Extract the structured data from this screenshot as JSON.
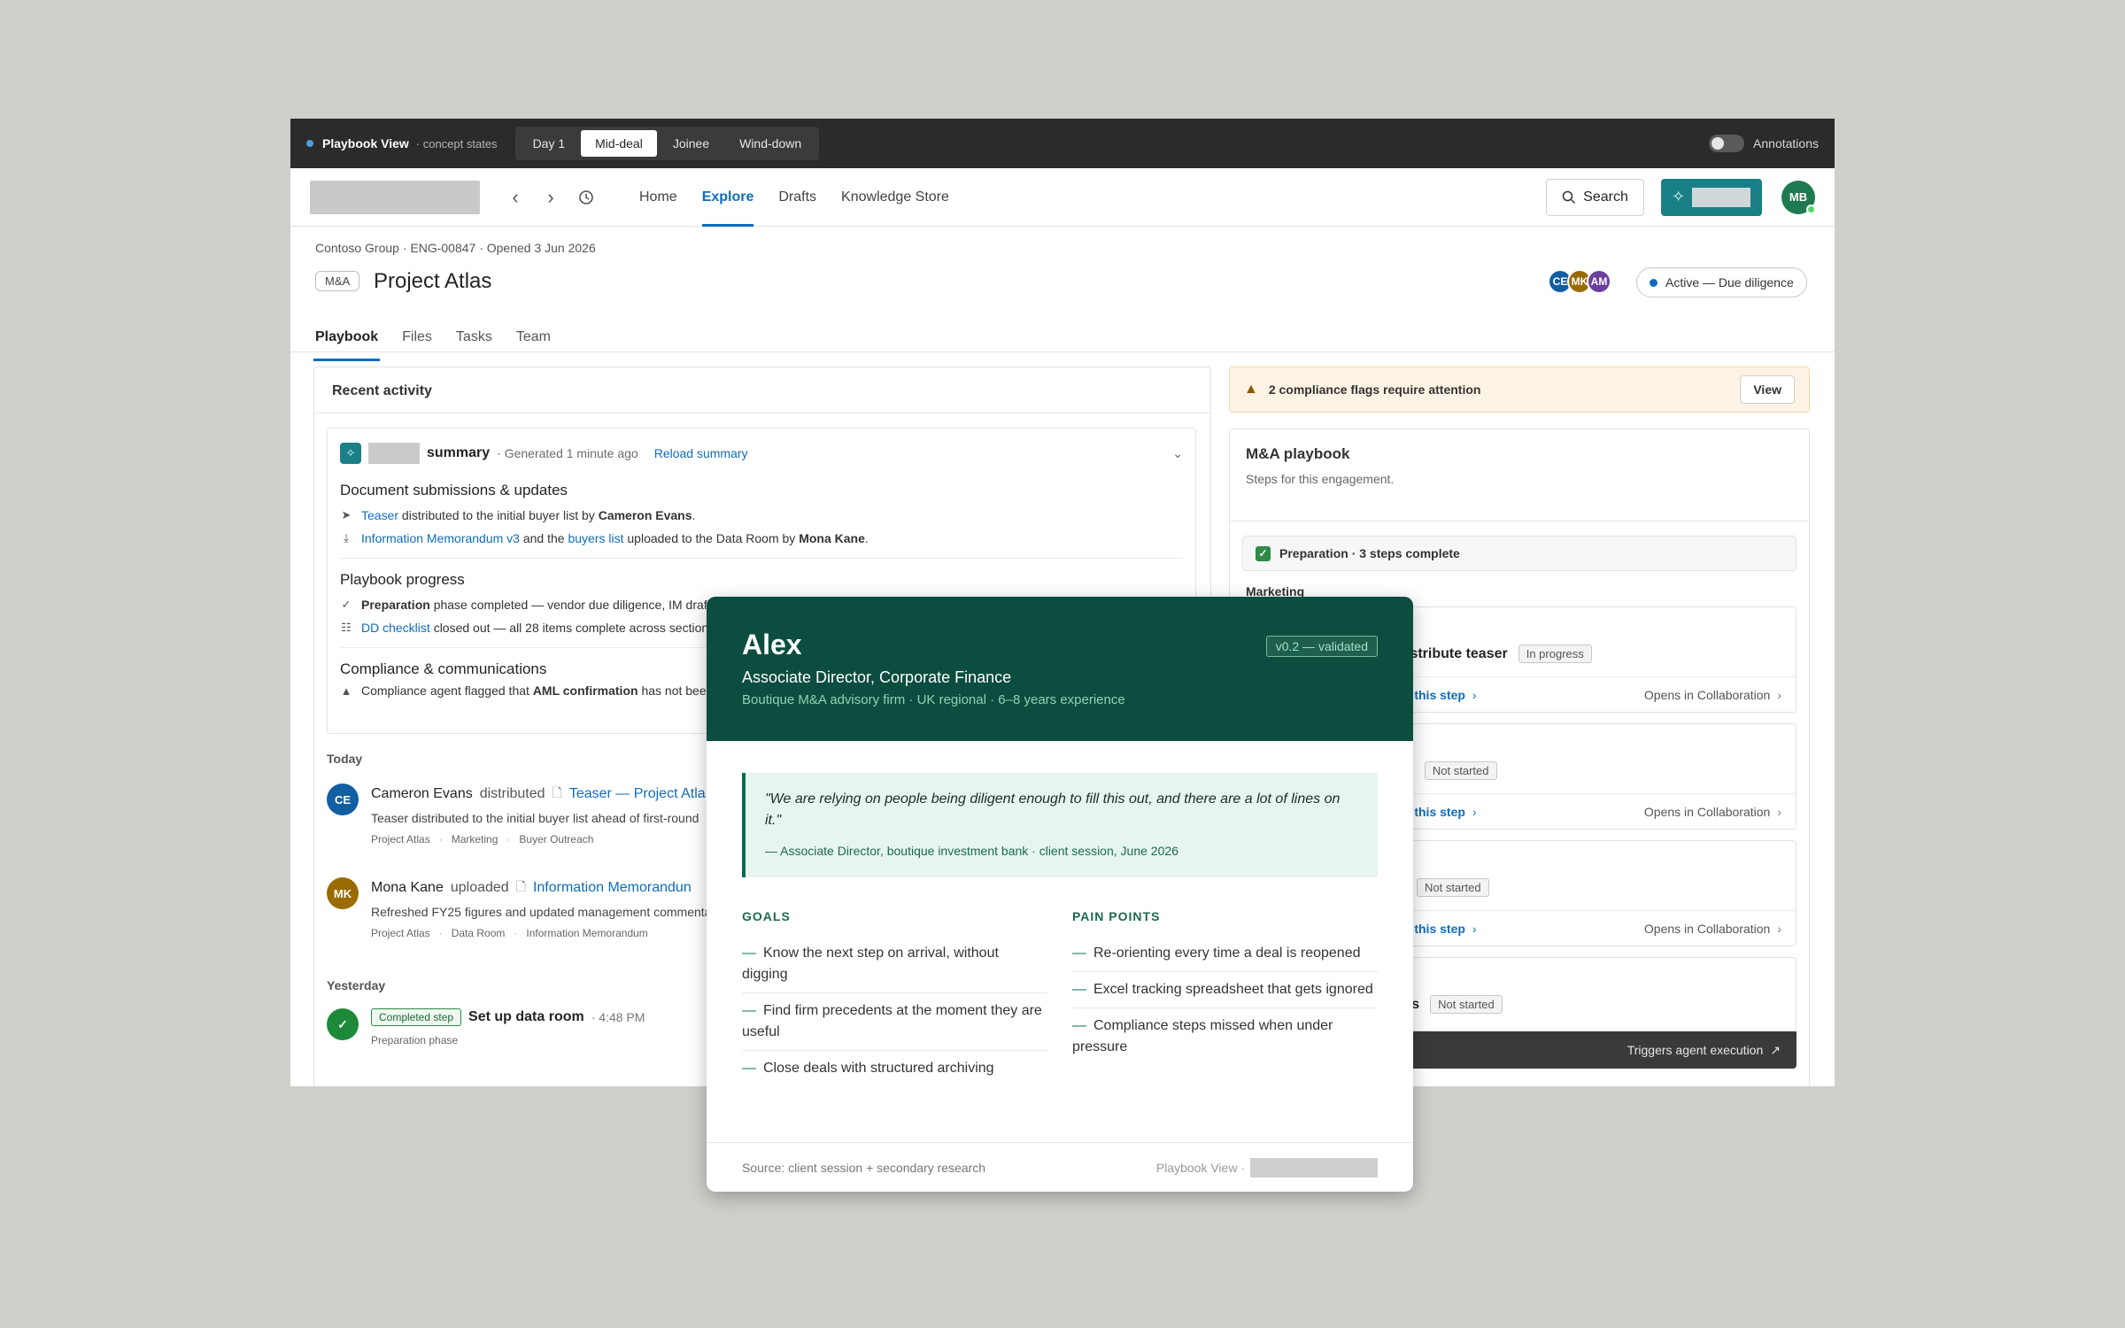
{
  "concept_bar": {
    "title": "Playbook View",
    "subtitle": "· concept states",
    "states": [
      "Day 1",
      "Mid-deal",
      "Joinee",
      "Wind-down"
    ],
    "active_state": "Mid-deal",
    "annotations_label": "Annotations"
  },
  "nav": {
    "items": [
      "Home",
      "Explore",
      "Drafts",
      "Knowledge Store"
    ],
    "active": "Explore",
    "search_label": "Search",
    "user_initials": "MB"
  },
  "project": {
    "meta": "Contoso Group · ENG-00847 · Opened 3 Jun 2026",
    "tag": "M&A",
    "title": "Project Atlas",
    "members": [
      {
        "initials": "CE",
        "color": "#115ea3"
      },
      {
        "initials": "MK",
        "color": "#9a6b00"
      },
      {
        "initials": "AM",
        "color": "#6b3fa0"
      }
    ],
    "status": "Active — Due diligence",
    "tabs": [
      "Playbook",
      "Files",
      "Tasks",
      "Team"
    ],
    "active_tab": "Playbook"
  },
  "activity": {
    "header": "Recent activity",
    "summary": {
      "title": "summary",
      "generated": "· Generated 1 minute ago",
      "reload": "Reload summary",
      "sections": {
        "docs": {
          "heading": "Document submissions & updates",
          "i1_link": "Teaser",
          "i1_text": "distributed to the initial buyer list by",
          "i1_person": "Cameron Evans",
          "i1_end": ".",
          "i2_link1": "Information Memorandum v3",
          "i2_mid": "and the",
          "i2_link2": "buyers list",
          "i2_text": "uploaded to the Data Room by",
          "i2_person": "Mona Kane",
          "i2_end": "."
        },
        "progress": {
          "heading": "Playbook progress",
          "i1_bold": "Preparation",
          "i1_text": "phase completed — vendor due diligence, IM draf",
          "i2_link": "DD checklist",
          "i2_text": "closed out — all 28 items complete across section"
        },
        "compliance": {
          "heading": "Compliance & communications",
          "i1_text": "Compliance agent flagged that",
          "i1_bold": "AML confirmation",
          "i1_rest": "has not bee"
        }
      }
    },
    "today_label": "Today",
    "yesterday_label": "Yesterday",
    "items": [
      {
        "initials": "CE",
        "color": "#115ea3",
        "name": "Cameron Evans",
        "verb": "distributed",
        "doc": "Teaser — Project Atla",
        "desc": "Teaser distributed to the initial buyer list ahead of first-round",
        "tags": [
          "Project Atlas",
          "Marketing",
          "Buyer Outreach"
        ]
      },
      {
        "initials": "MK",
        "color": "#9a6b00",
        "name": "Mona Kane",
        "verb": "uploaded",
        "doc": "Information Memorandun",
        "desc": "Refreshed FY25 figures and updated management commenta",
        "tags": [
          "Project Atlas",
          "Data Room",
          "Information Memorandum"
        ]
      }
    ],
    "completed": {
      "badge": "Completed step",
      "title": "Set up data room",
      "time": "· 4:48 PM",
      "phase": "Preparation phase"
    }
  },
  "right": {
    "flag_text": "2 compliance flags require attention",
    "flag_view": "View",
    "playbook_title": "M&A playbook",
    "playbook_sub": "Steps for this engagement.",
    "prep_text": "Preparation · 3 steps complete",
    "marketing_label": "Marketing",
    "steps": [
      {
        "title": "istribute teaser",
        "status": "In progress",
        "link": "r this step",
        "opens": "Opens in Collaboration"
      },
      {
        "title": "s",
        "status": "Not started",
        "link": "r this step",
        "opens": "Opens in Collaboration"
      },
      {
        "title": "",
        "status": "Not started",
        "link": "r this step",
        "opens": "Opens in Collaboration"
      },
      {
        "title": "rs",
        "status": "Not started",
        "link": "",
        "opens": ""
      }
    ],
    "dark_bar_text": "Triggers agent execution"
  },
  "persona": {
    "name": "Alex",
    "role": "Associate Director, Corporate Finance",
    "org": "Boutique M&A advisory firm · UK regional · 6–8 years experience",
    "version": "v0.2 — validated",
    "quote": "\"We are relying on people being diligent enough to fill this out, and there are a lot of lines on it.\"",
    "quote_source": "— Associate Director, boutique investment bank · client session, June 2026",
    "goals_heading": "GOALS",
    "goals": [
      "Know the next step on arrival, without digging",
      "Find firm precedents at the moment they are useful",
      "Close deals with structured archiving"
    ],
    "pain_heading": "PAIN POINTS",
    "pains": [
      "Re-orienting every time a deal is reopened",
      "Excel tracking spreadsheet that gets ignored",
      "Compliance steps missed when under pressure"
    ],
    "source": "Source: client session + secondary research",
    "footer_right": "Playbook View ·"
  }
}
